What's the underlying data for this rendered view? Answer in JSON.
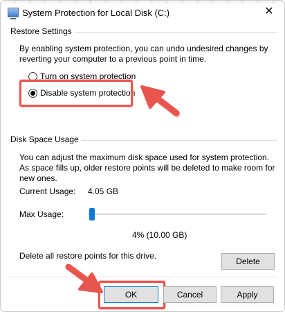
{
  "window": {
    "title": "System Protection for Local Disk (C:)",
    "close_glyph": "✕"
  },
  "restore_settings": {
    "heading": "Restore Settings",
    "description": "By enabling system protection, you can undo undesired changes by reverting your computer to a previous point in time.",
    "options": [
      {
        "label": "Turn on system protection",
        "selected": false
      },
      {
        "label": "Disable system protection",
        "selected": true
      }
    ]
  },
  "disk_space": {
    "heading": "Disk Space Usage",
    "description": "You can adjust the maximum disk space used for system protection. As space fills up, older restore points will be deleted to make room for new ones.",
    "current_usage_label": "Current Usage:",
    "current_usage_value": "4.05 GB",
    "max_usage_label": "Max Usage:",
    "max_usage_value": "4% (10.00 GB)",
    "max_usage_percent": 4
  },
  "delete_section": {
    "text": "Delete all restore points for this drive.",
    "delete_label": "Delete"
  },
  "footer": {
    "ok_label": "OK",
    "cancel_label": "Cancel",
    "apply_label": "Apply"
  },
  "colors": {
    "annotation_red": "#e8554e",
    "accent_blue": "#0078d7"
  }
}
